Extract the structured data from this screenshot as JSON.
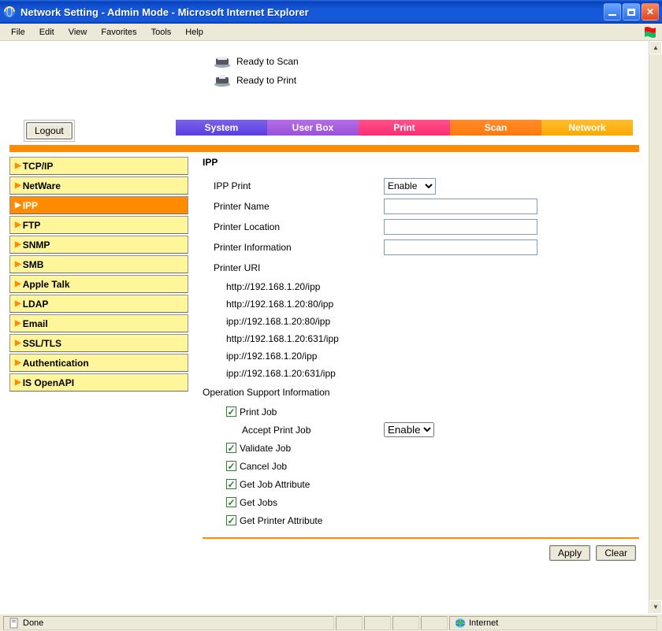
{
  "window": {
    "title": "Network Setting - Admin Mode - Microsoft Internet Explorer"
  },
  "menu": {
    "file": "File",
    "edit": "Edit",
    "view": "View",
    "favorites": "Favorites",
    "tools": "Tools",
    "help": "Help"
  },
  "status_lines": {
    "scan": "Ready to Scan",
    "print": "Ready to Print"
  },
  "buttons": {
    "logout": "Logout",
    "apply": "Apply",
    "clear": "Clear"
  },
  "tabs": {
    "system": "System",
    "userbox": "User Box",
    "print": "Print",
    "scan": "Scan",
    "network": "Network"
  },
  "sidebar": {
    "items": [
      {
        "label": "TCP/IP"
      },
      {
        "label": "NetWare"
      },
      {
        "label": "IPP"
      },
      {
        "label": "FTP"
      },
      {
        "label": "SNMP"
      },
      {
        "label": "SMB"
      },
      {
        "label": "Apple Talk"
      },
      {
        "label": "LDAP"
      },
      {
        "label": "Email"
      },
      {
        "label": "SSL/TLS"
      },
      {
        "label": "Authentication"
      },
      {
        "label": "IS OpenAPI"
      }
    ],
    "active_index": 2
  },
  "ipp": {
    "heading": "IPP",
    "labels": {
      "ipp_print": "IPP Print",
      "printer_name": "Printer Name",
      "printer_location": "Printer Location",
      "printer_info": "Printer Information",
      "printer_uri": "Printer URI",
      "op_support": "Operation Support Information",
      "accept_print_job": "Accept Print Job"
    },
    "ipp_print_value": "Enable",
    "printer_name_value": "",
    "printer_location_value": "",
    "printer_info_value": "",
    "uris": [
      "http://192.168.1.20/ipp",
      "http://192.168.1.20:80/ipp",
      "ipp://192.168.1.20:80/ipp",
      "http://192.168.1.20:631/ipp",
      "ipp://192.168.1.20/ipp",
      "ipp://192.168.1.20:631/ipp"
    ],
    "operations": [
      {
        "label": "Print Job",
        "checked": true
      },
      {
        "label": "Validate Job",
        "checked": true
      },
      {
        "label": "Cancel Job",
        "checked": true
      },
      {
        "label": "Get Job Attribute",
        "checked": true
      },
      {
        "label": "Get Jobs",
        "checked": true
      },
      {
        "label": "Get Printer Attribute",
        "checked": true
      }
    ],
    "accept_print_job_value": "Enable"
  },
  "statusbar": {
    "left": "Done",
    "zone": "Internet"
  }
}
